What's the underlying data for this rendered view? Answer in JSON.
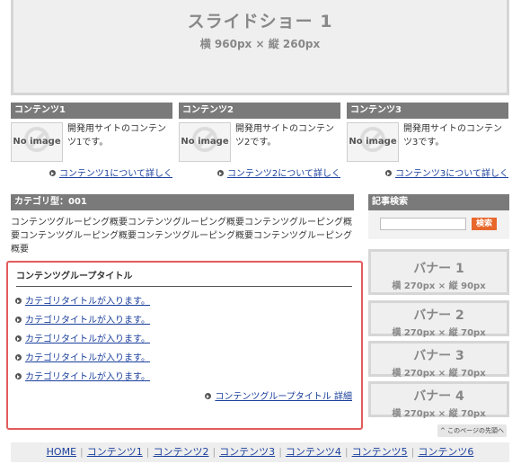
{
  "slideshow": {
    "title": "スライドショー 1",
    "size": "横 960px × 縦 260px"
  },
  "contents": [
    {
      "heading": "コンテンツ1",
      "image_label": "No image",
      "description": "開発用サイトのコンテンツ1です。",
      "link": "コンテンツ1について詳しく"
    },
    {
      "heading": "コンテンツ2",
      "image_label": "No image",
      "description": "開発用サイトのコンテンツ2です。",
      "link": "コンテンツ2について詳しく"
    },
    {
      "heading": "コンテンツ3",
      "image_label": "No image",
      "description": "開発用サイトのコンテンツ3です。",
      "link": "コンテンツ3について詳しく"
    }
  ],
  "category": {
    "heading": "カテゴリ型：001",
    "summary": "コンテンツグルーピング概要コンテンツグルーピング概要コンテンツグルーピング概要コンテンツグルーピング概要コンテンツグルーピング概要コンテンツグルーピング概要"
  },
  "group": {
    "title": "コンテンツグループタイトル",
    "items": [
      "カテゴリタイトルが入ります。",
      "カテゴリタイトルが入ります。",
      "カテゴリタイトルが入ります。",
      "カテゴリタイトルが入ります。",
      "カテゴリタイトルが入ります。"
    ],
    "detail_link": "コンテンツグループタイトル 詳細"
  },
  "search": {
    "heading": "記事検索",
    "button": "検索",
    "value": ""
  },
  "banners": [
    {
      "title": "バナー 1",
      "size": "横 270px × 縦 90px"
    },
    {
      "title": "バナー 2",
      "size": "横 270px × 縦 70px"
    },
    {
      "title": "バナー 3",
      "size": "横 270px × 縦 70px"
    },
    {
      "title": "バナー 4",
      "size": "横 270px × 縦 70px"
    }
  ],
  "to_top": "^ このページの先頭へ",
  "footer": [
    "HOME",
    "コンテンツ1",
    "コンテンツ2",
    "コンテンツ3",
    "コンテンツ4",
    "コンテンツ5",
    "コンテンツ6"
  ],
  "colors": {
    "accent_button": "#e8672b",
    "group_border": "#e25c5c",
    "bar": "#7a7a7a",
    "link": "#1a3f9c"
  }
}
